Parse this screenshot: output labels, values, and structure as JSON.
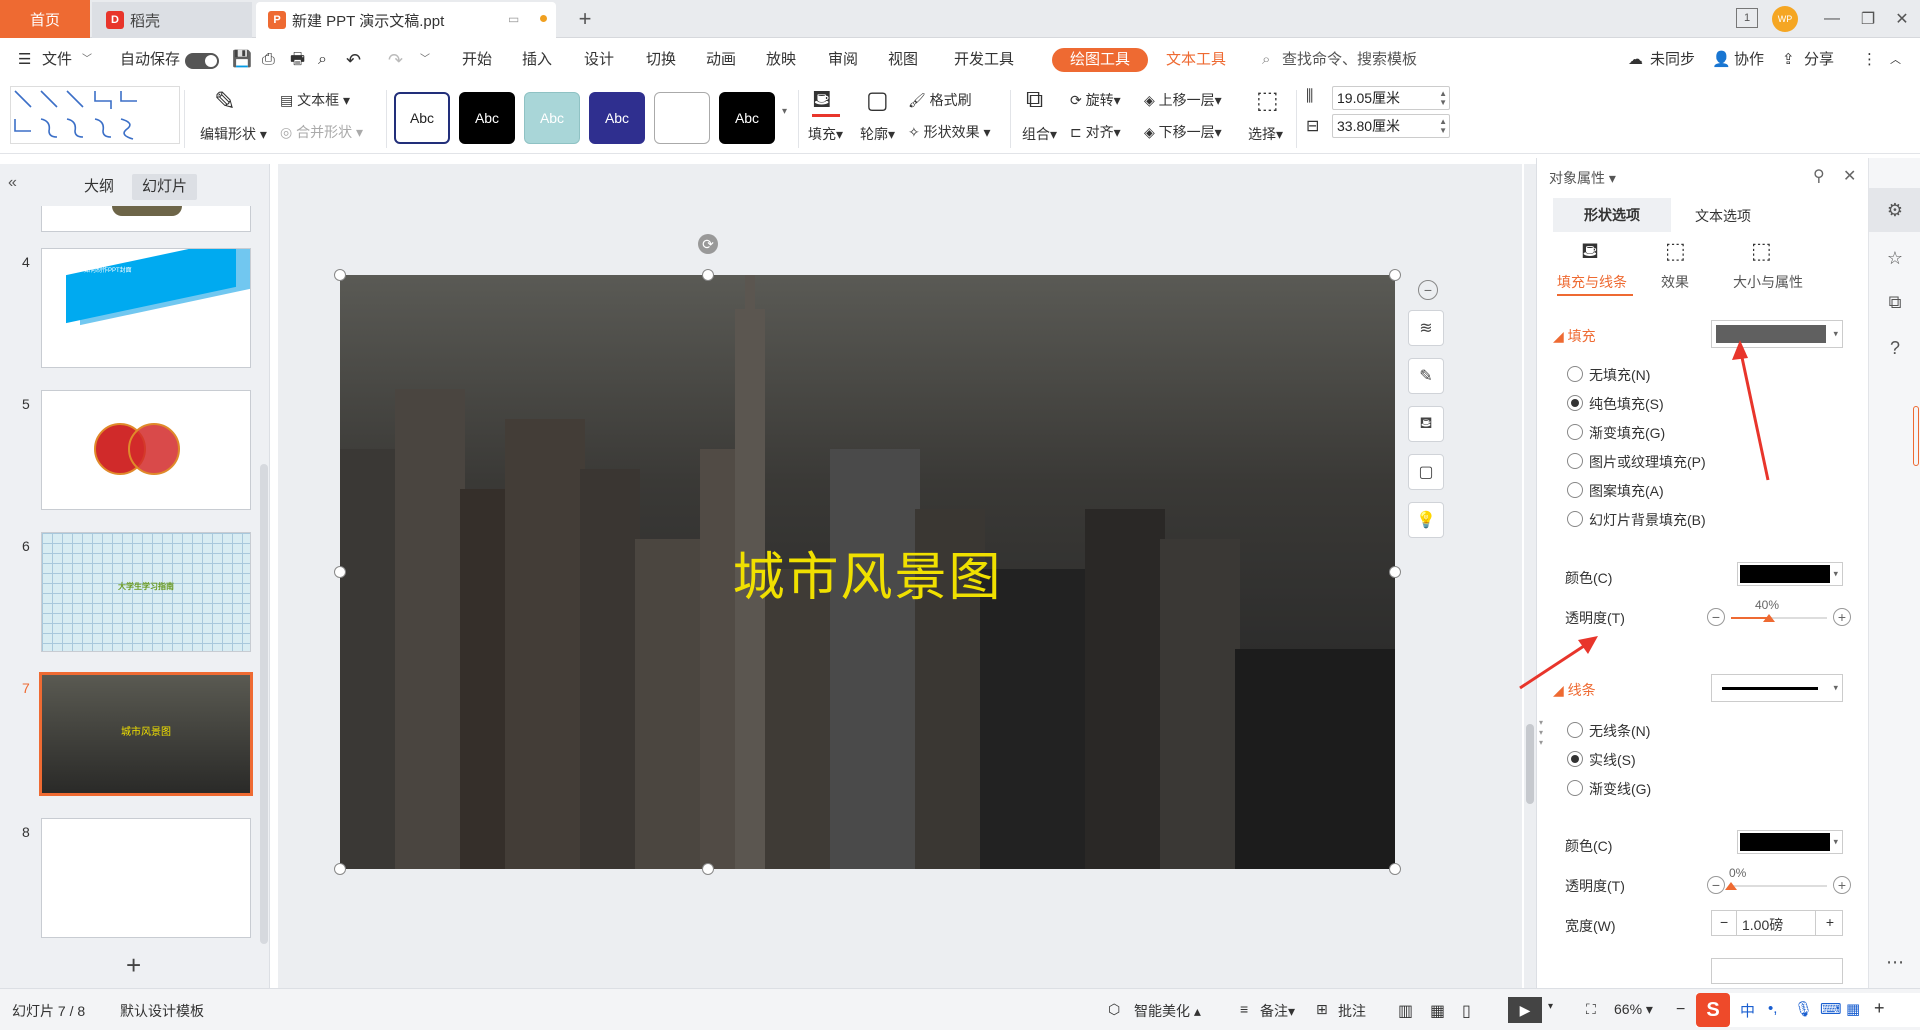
{
  "titlebar": {
    "home_tab": "首页",
    "daoke_tab": "稻壳",
    "doc_tab": "新建 PPT 演示文稿.ppt",
    "new_tab": "+",
    "avatar_text": "WP",
    "page_badge": "1"
  },
  "menubar": {
    "file": "文件",
    "autosave": "自动保存",
    "items": [
      "开始",
      "插入",
      "设计",
      "切换",
      "动画",
      "放映",
      "审阅",
      "视图",
      "开发工具"
    ],
    "drawing_tools": "绘图工具",
    "text_tools": "文本工具",
    "search_placeholder": "查找命令、搜索模板",
    "unsync": "未同步",
    "collab": "协作",
    "share": "分享"
  },
  "ribbon": {
    "edit_shape": "编辑形状",
    "text_box": "文本框",
    "merge_shape": "合并形状",
    "style_label": "Abc",
    "fill": "填充",
    "outline": "轮廓",
    "format_painter": "格式刷",
    "shape_effect": "形状效果",
    "group": "组合",
    "rotate": "旋转",
    "align": "对齐",
    "bring_forward": "上移一层",
    "send_backward": "下移一层",
    "select": "选择",
    "height": "19.05厘米",
    "width": "33.80厘米"
  },
  "leftpanel": {
    "outline_tab": "大纲",
    "slides_tab": "幻灯片",
    "thumbs": [
      {
        "num": "4",
        "text": "如何制作PPT封面"
      },
      {
        "num": "5",
        "text": ""
      },
      {
        "num": "6",
        "text": "大学生学习指南"
      },
      {
        "num": "7",
        "text": "城市风景图"
      },
      {
        "num": "8",
        "text": ""
      }
    ],
    "add": "+"
  },
  "slide": {
    "title": "城市风景图"
  },
  "rightpanel": {
    "header": "对象属性",
    "tab_shape": "形状选项",
    "tab_text": "文本选项",
    "sub_fill_line": "填充与线条",
    "sub_effect": "效果",
    "sub_size": "大小与属性",
    "fill_section": "填充",
    "fill_options": [
      "无填充(N)",
      "纯色填充(S)",
      "渐变填充(G)",
      "图片或纹理填充(P)",
      "图案填充(A)",
      "幻灯片背景填充(B)"
    ],
    "fill_selected": 1,
    "color_label": "颜色(C)",
    "transparency_label": "透明度(T)",
    "fill_transparency": "40%",
    "line_section": "线条",
    "line_options": [
      "无线条(N)",
      "实线(S)",
      "渐变线(G)"
    ],
    "line_selected": 1,
    "line_color_label": "颜色(C)",
    "line_transparency_label": "透明度(T)",
    "line_transparency": "0%",
    "width_label": "宽度(W)",
    "width_value": "1.00磅",
    "fill_color": "#606060",
    "swatch_color": "#000000"
  },
  "statusbar": {
    "slide_info": "幻灯片 7 / 8",
    "template": "默认设计模板",
    "beautify": "智能美化",
    "notes": "备注",
    "comments": "批注",
    "zoom": "66%",
    "ime": "中"
  },
  "colors": {
    "accent": "#ee6a32",
    "title_yellow": "#f0e000",
    "arrow_red": "#e8352b"
  }
}
